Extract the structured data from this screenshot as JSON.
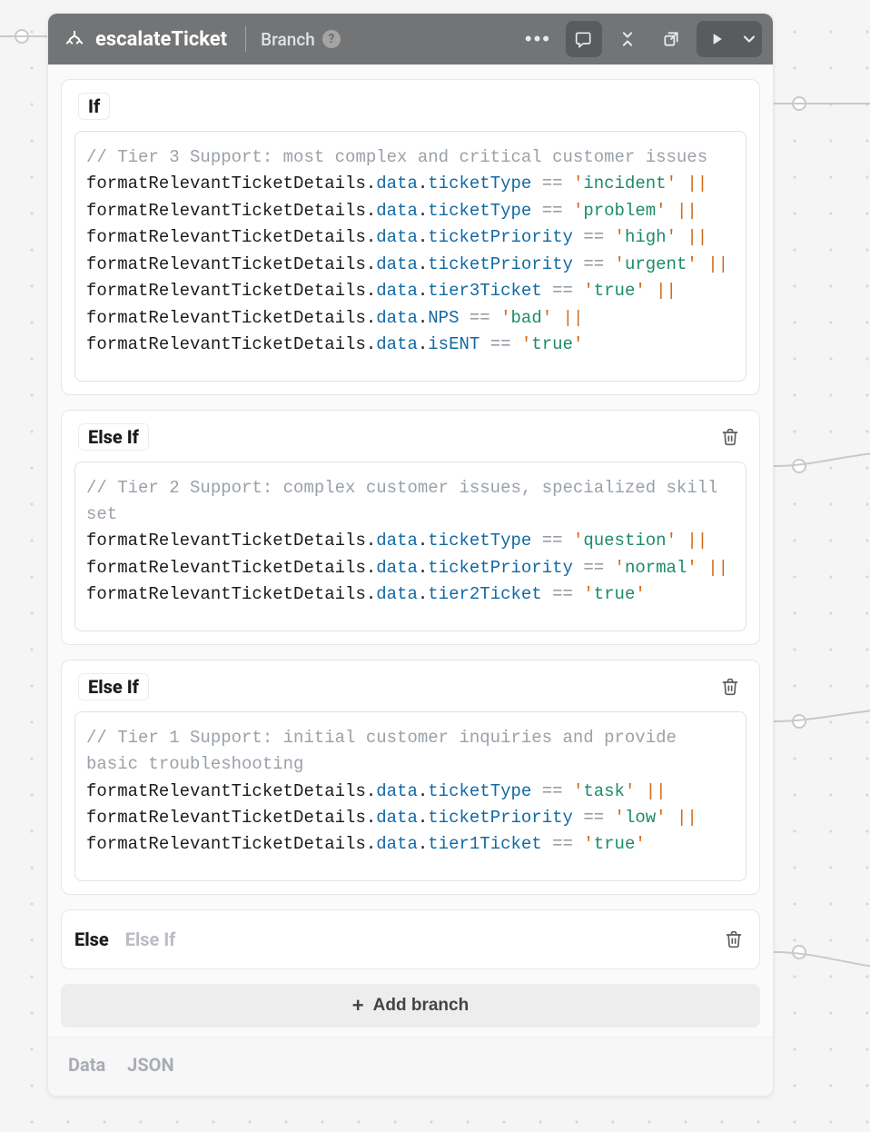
{
  "header": {
    "title": "escalateTicket",
    "subtitle": "Branch"
  },
  "branches": [
    {
      "label": "If",
      "has_delete": false,
      "code": {
        "comment": "// Tier 3 Support: most complex and critical customer issues",
        "lines": [
          {
            "obj": "formatRelevantTicketDetails",
            "data": "data",
            "prop": "ticketType",
            "op": "==",
            "val": "incident",
            "trailing": "||"
          },
          {
            "obj": "formatRelevantTicketDetails",
            "data": "data",
            "prop": "ticketType",
            "op": "==",
            "val": "problem",
            "trailing": "||"
          },
          {
            "obj": "formatRelevantTicketDetails",
            "data": "data",
            "prop": "ticketPriority",
            "op": "==",
            "val": "high",
            "trailing": "||"
          },
          {
            "obj": "formatRelevantTicketDetails",
            "data": "data",
            "prop": "ticketPriority",
            "op": "==",
            "val": "urgent",
            "trailing": "||"
          },
          {
            "obj": "formatRelevantTicketDetails",
            "data": "data",
            "prop": "tier3Ticket",
            "op": "==",
            "val": "true",
            "trailing": "||"
          },
          {
            "obj": "formatRelevantTicketDetails",
            "data": "data",
            "prop": "NPS",
            "op": "==",
            "val": "bad",
            "trailing": "||"
          },
          {
            "obj": "formatRelevantTicketDetails",
            "data": "data",
            "prop": "isENT",
            "op": "==",
            "val": "true",
            "trailing": ""
          }
        ]
      }
    },
    {
      "label": "Else If",
      "has_delete": true,
      "code": {
        "comment": "// Tier 2 Support: complex customer issues, specialized skill set",
        "lines": [
          {
            "obj": "formatRelevantTicketDetails",
            "data": "data",
            "prop": "ticketType",
            "op": "==",
            "val": "question",
            "trailing": "||"
          },
          {
            "obj": "formatRelevantTicketDetails",
            "data": "data",
            "prop": "ticketPriority",
            "op": "==",
            "val": "normal",
            "trailing": "||"
          },
          {
            "obj": "formatRelevantTicketDetails",
            "data": "data",
            "prop": "tier2Ticket",
            "op": "==",
            "val": "true",
            "trailing": ""
          }
        ]
      }
    },
    {
      "label": "Else If",
      "has_delete": true,
      "code": {
        "comment": "// Tier 1 Support: initial customer inquiries and provide basic troubleshooting",
        "lines": [
          {
            "obj": "formatRelevantTicketDetails",
            "data": "data",
            "prop": "ticketType",
            "op": "==",
            "val": "task",
            "trailing": "||"
          },
          {
            "obj": "formatRelevantTicketDetails",
            "data": "data",
            "prop": "ticketPriority",
            "op": "==",
            "val": "low",
            "trailing": "||"
          },
          {
            "obj": "formatRelevantTicketDetails",
            "data": "data",
            "prop": "tier1Ticket",
            "op": "==",
            "val": "true",
            "trailing": ""
          }
        ]
      }
    }
  ],
  "else_row": {
    "label": "Else",
    "alt_label": "Else If"
  },
  "add_branch_label": "Add branch",
  "footer_tabs": [
    "Data",
    "JSON"
  ]
}
